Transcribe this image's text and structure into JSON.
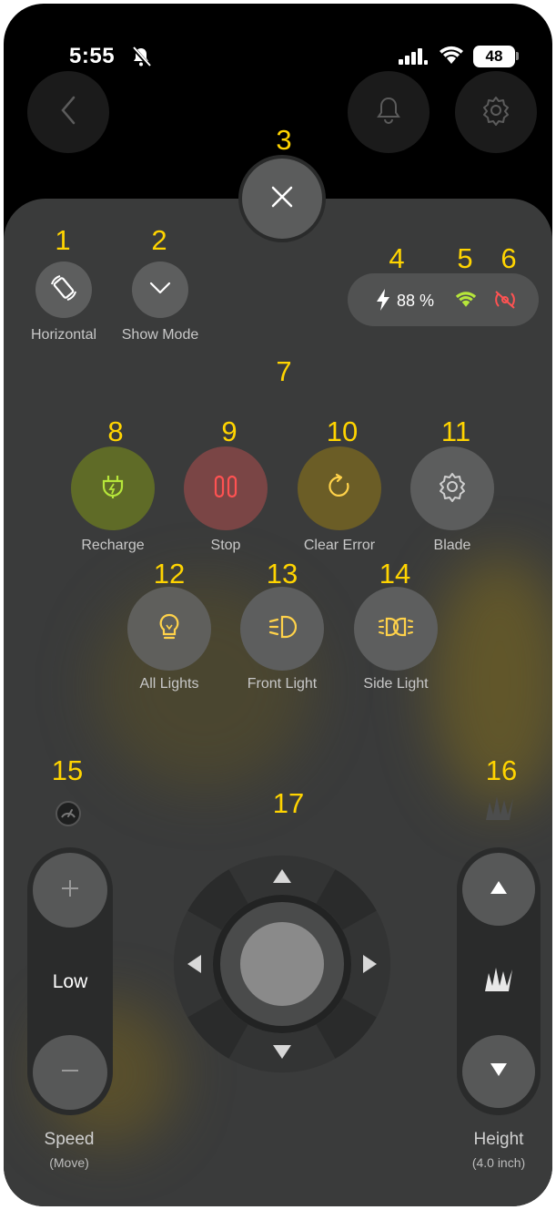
{
  "status_bar": {
    "time": "5:55",
    "battery": "48"
  },
  "annotations": [
    "1",
    "2",
    "3",
    "4",
    "5",
    "6",
    "7",
    "8",
    "9",
    "10",
    "11",
    "12",
    "13",
    "14",
    "15",
    "16",
    "17"
  ],
  "mode_buttons": [
    {
      "label": "Horizontal",
      "icon": "rotate-icon"
    },
    {
      "label": "Show Mode",
      "icon": "chevron-down-icon"
    }
  ],
  "status_indicator": {
    "battery_percent": "88 %",
    "icons": [
      "bolt-icon",
      "wifi-icon",
      "signal-off-icon"
    ]
  },
  "action_buttons": [
    {
      "label": "Recharge",
      "icon": "plug-icon",
      "color": "#5f6b27"
    },
    {
      "label": "Stop",
      "icon": "pause-icon",
      "color": "#7a4545"
    },
    {
      "label": "Clear Error",
      "icon": "refresh-icon",
      "color": "#6b5d26"
    },
    {
      "label": "Blade",
      "icon": "gear-icon",
      "color": "#5c5d5d"
    }
  ],
  "light_buttons": [
    {
      "label": "All Lights",
      "icon": "bulb-icon"
    },
    {
      "label": "Front Light",
      "icon": "front-light-icon"
    },
    {
      "label": "Side Light",
      "icon": "side-light-icon"
    }
  ],
  "speed": {
    "value": "Low",
    "label": "Speed",
    "sublabel": "(Move)"
  },
  "height": {
    "label": "Height",
    "sublabel": "(4.0 inch)"
  },
  "colors": {
    "accent_yellow": "#ffd400",
    "green": "#b6e63a",
    "red": "#ff5252",
    "amber": "#ffd24a"
  }
}
